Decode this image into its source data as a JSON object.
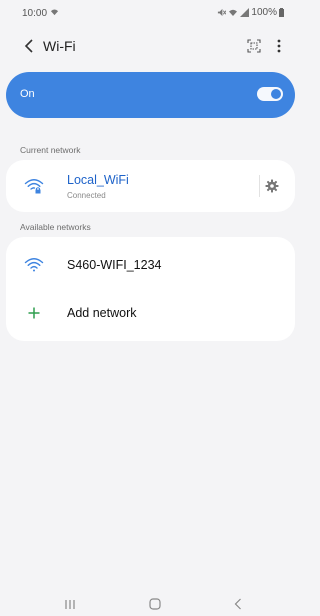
{
  "status_bar": {
    "time": "10:00",
    "battery": "100%",
    "icons": [
      "wifi-icon",
      "mute-icon",
      "signal-icon",
      "battery-icon"
    ]
  },
  "app_bar": {
    "title": "Wi-Fi",
    "icons": [
      "back-icon",
      "qr-scan-icon",
      "more-icon"
    ]
  },
  "wifi_toggle": {
    "label": "On",
    "enabled": true
  },
  "current_network": {
    "section_label": "Current network",
    "name": "Local_WiFi",
    "status": "Connected",
    "icons": [
      "wifi-lock-icon",
      "gear-icon"
    ]
  },
  "available_networks": {
    "section_label": "Available networks",
    "items": [
      {
        "name": "S460-WIFI_1234",
        "icon": "wifi-icon"
      }
    ],
    "add_label": "Add network"
  },
  "nav_bar": {
    "icons": [
      "recent-apps-icon",
      "home-icon",
      "back-nav-icon"
    ]
  },
  "colors": {
    "accent": "#3e84e0",
    "link_text": "#1e63c9",
    "add_plus": "#2e9e4e",
    "background": "#f4f4f6"
  }
}
